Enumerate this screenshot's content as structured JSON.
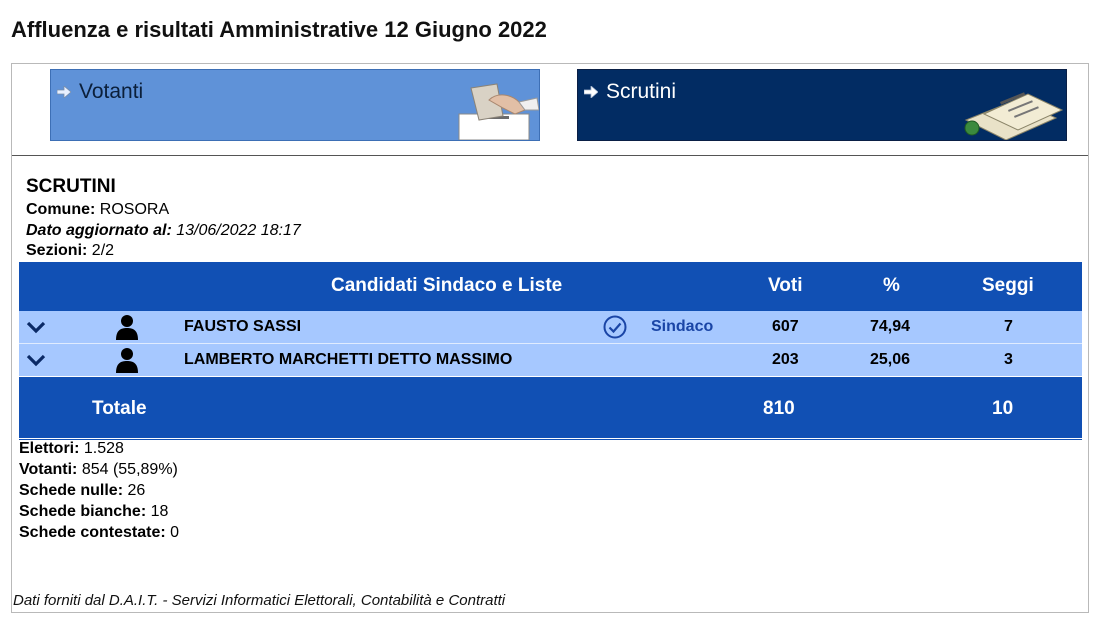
{
  "page": {
    "title": "Affluenza e risultati Amministrative 12 Giugno 2022"
  },
  "tabs": [
    {
      "label": "Votanti",
      "color": "#5f92d8"
    },
    {
      "label": "Scrutini",
      "color": "#022c63"
    }
  ],
  "section": {
    "title": "SCRUTINI",
    "comune_label": "Comune:",
    "comune_value": "ROSORA",
    "dato_label": "Dato aggiornato al:",
    "dato_value": "13/06/2022 18:17",
    "sezioni_label": "Sezioni:",
    "sezioni_value": "2/2"
  },
  "table": {
    "headers": {
      "candidati": "Candidati Sindaco e Liste",
      "voti": "Voti",
      "percent": "%",
      "seggi": "Seggi"
    },
    "rows": [
      {
        "name": "FAUSTO SASSI",
        "elected_label": "Sindaco",
        "elected": true,
        "voti": "607",
        "percent": "74,94",
        "seggi": "7"
      },
      {
        "name": "LAMBERTO MARCHETTI DETTO MASSIMO",
        "elected_label": "",
        "elected": false,
        "voti": "203",
        "percent": "25,06",
        "seggi": "3"
      }
    ],
    "total": {
      "label": "Totale",
      "voti": "810",
      "seggi": "10"
    },
    "colors": {
      "header_bg": "#1150b4",
      "row_bg": "#a6c8ff",
      "accent": "#1a45a6"
    }
  },
  "stats": {
    "elettori_label": "Elettori:",
    "elettori_value": "1.528",
    "votanti_label": "Votanti:",
    "votanti_value": "854 (55,89%)",
    "nulle_label": "Schede nulle:",
    "nulle_value": "26",
    "bianche_label": "Schede bianche:",
    "bianche_value": "18",
    "contestate_label": "Schede contestate:",
    "contestate_value": "0"
  },
  "footer": {
    "note": "Dati forniti dal D.A.I.T. - Servizi Informatici Elettorali, Contabilità e Contratti"
  }
}
